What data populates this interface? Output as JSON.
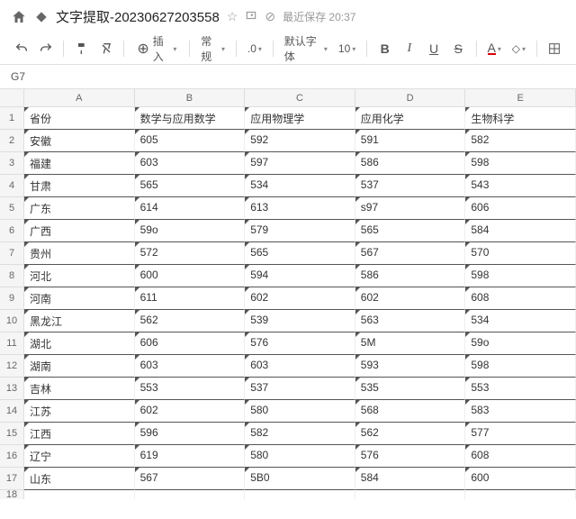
{
  "header": {
    "title": "文字提取-20230627203558",
    "save_label": "最近保存 20:37"
  },
  "toolbar": {
    "insert_label": "插入",
    "format_label": "常规",
    "decimal_label": ".0",
    "font_label": "默认字体",
    "font_size": "10",
    "bold": "B",
    "italic": "I",
    "underline": "U",
    "strike": "S",
    "font_color": "A",
    "fill_color": "◆"
  },
  "cell_ref": "G7",
  "columns": [
    "A",
    "B",
    "C",
    "D",
    "E"
  ],
  "rows": [
    {
      "n": "1",
      "cells": [
        "省份",
        "数学与应用数学",
        "应用物理学",
        "应用化学",
        "生物科学"
      ]
    },
    {
      "n": "2",
      "cells": [
        "安徽",
        "605",
        "592",
        "591",
        "582"
      ]
    },
    {
      "n": "3",
      "cells": [
        "福建",
        "603",
        "597",
        "586",
        "598"
      ]
    },
    {
      "n": "4",
      "cells": [
        "甘肃",
        "565",
        "534",
        "537",
        "543"
      ]
    },
    {
      "n": "5",
      "cells": [
        "广东",
        "614",
        "613",
        "s97",
        "606"
      ]
    },
    {
      "n": "6",
      "cells": [
        "广西",
        "59o",
        "579",
        "565",
        "584"
      ]
    },
    {
      "n": "7",
      "cells": [
        "贵州",
        "572",
        "565",
        "567",
        "570"
      ]
    },
    {
      "n": "8",
      "cells": [
        "河北",
        "600",
        "594",
        "586",
        "598"
      ]
    },
    {
      "n": "9",
      "cells": [
        "河南",
        "611",
        "602",
        "602",
        "608"
      ]
    },
    {
      "n": "10",
      "cells": [
        "黑龙江",
        "562",
        "539",
        "563",
        "534"
      ]
    },
    {
      "n": "11",
      "cells": [
        "湖北",
        "606",
        "576",
        "5M",
        "59o"
      ]
    },
    {
      "n": "12",
      "cells": [
        "湖南",
        "603",
        "603",
        "593",
        "598"
      ]
    },
    {
      "n": "13",
      "cells": [
        "吉林",
        "553",
        "537",
        "535",
        "553"
      ]
    },
    {
      "n": "14",
      "cells": [
        "江苏",
        "602",
        "580",
        "568",
        "583"
      ]
    },
    {
      "n": "15",
      "cells": [
        "江西",
        "596",
        "582",
        "562",
        "577"
      ]
    },
    {
      "n": "16",
      "cells": [
        "辽宁",
        "619",
        "580",
        "576",
        "608"
      ]
    },
    {
      "n": "17",
      "cells": [
        "山东",
        "567",
        "5B0",
        "584",
        "600"
      ]
    }
  ]
}
